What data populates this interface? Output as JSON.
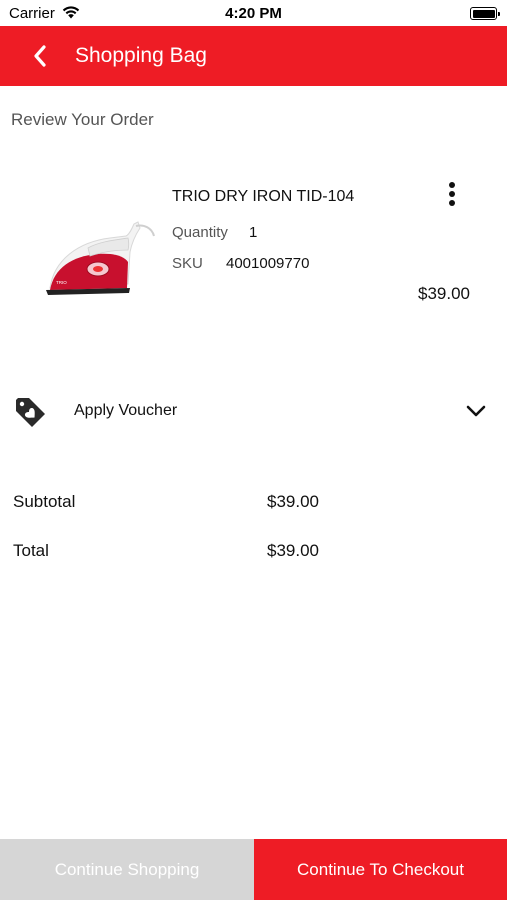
{
  "status_bar": {
    "carrier": "Carrier",
    "time": "4:20 PM",
    "icons": [
      "wifi-icon",
      "battery-icon"
    ]
  },
  "header": {
    "title": "Shopping Bag",
    "back_icon": "chevron-left-icon",
    "background_color": "#ee1c25"
  },
  "section": {
    "title": "Review Your Order"
  },
  "cart_item": {
    "name": "TRIO DRY IRON TID-104",
    "quantity_label": "Quantity",
    "quantity": "1",
    "sku_label": "SKU",
    "sku": "4001009770",
    "price": "$39.00",
    "menu_icon": "more-vertical-icon"
  },
  "voucher": {
    "label": "Apply Voucher",
    "icon": "tag-heart-icon",
    "expand_icon": "chevron-down-icon"
  },
  "totals": {
    "subtotal_label": "Subtotal",
    "subtotal_value": "$39.00",
    "total_label": "Total",
    "total_value": "$39.00"
  },
  "actions": {
    "continue_shopping": "Continue Shopping",
    "checkout": "Continue To Checkout",
    "checkout_color": "#ee1c25",
    "continue_color": "#d6d6d6"
  }
}
